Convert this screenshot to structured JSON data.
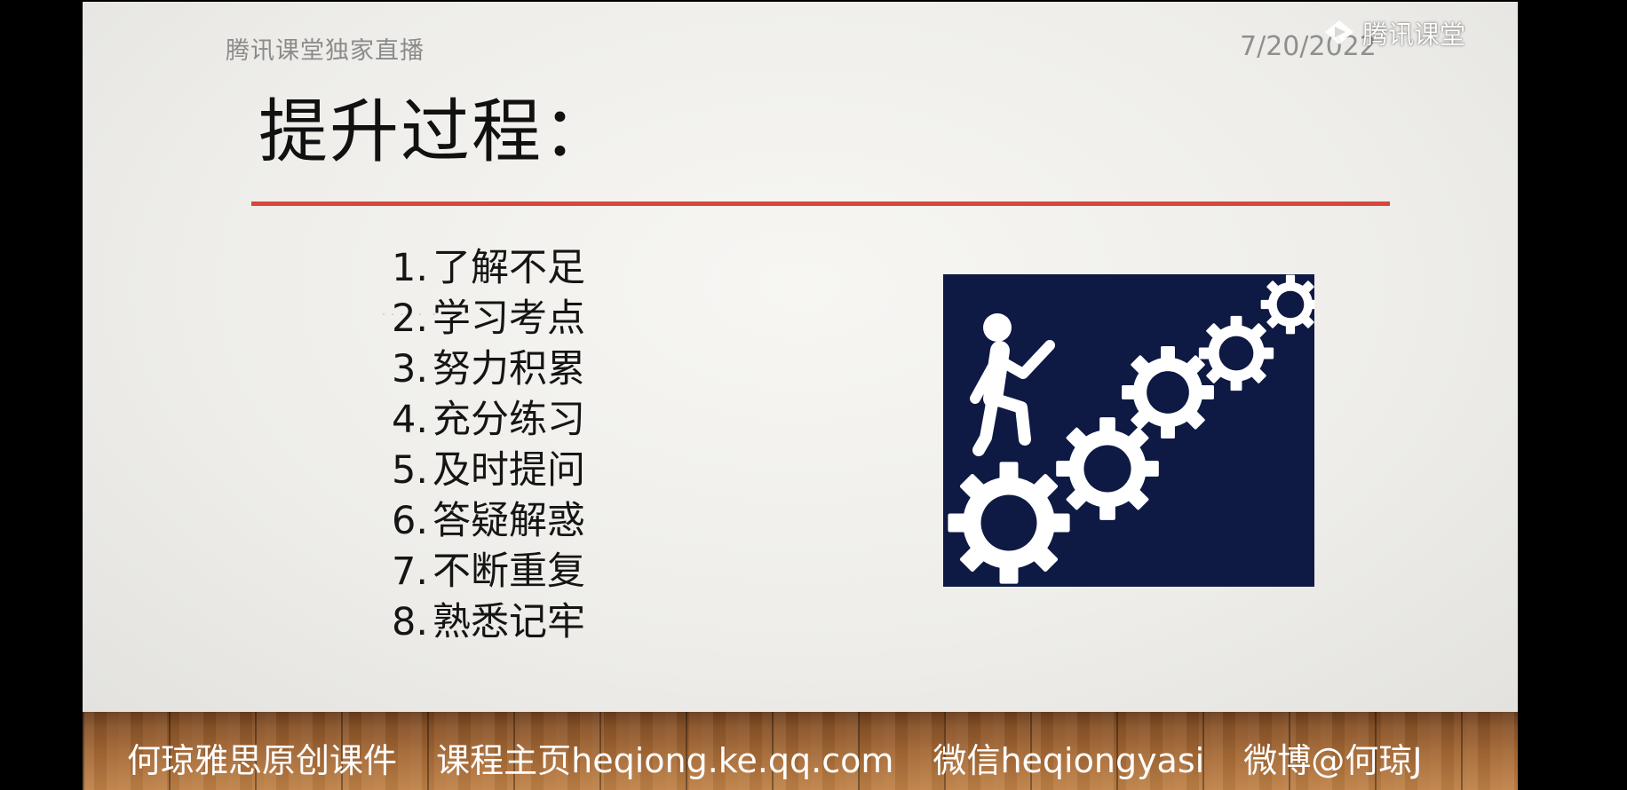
{
  "slide": {
    "header_left": "腾讯课堂独家直播",
    "date": "7/20/2022",
    "title": "提升过程：",
    "steps": [
      {
        "num": "1.",
        "text": "了解不足"
      },
      {
        "num": "2.",
        "text": "学习考点"
      },
      {
        "num": "3.",
        "text": "努力积累"
      },
      {
        "num": "4.",
        "text": "充分练习"
      },
      {
        "num": "5.",
        "text": "及时提问"
      },
      {
        "num": "6.",
        "text": "答疑解惑"
      },
      {
        "num": "7.",
        "text": "不断重复"
      },
      {
        "num": "8.",
        "text": "熟悉记牢"
      }
    ],
    "illustration_icon": "person-climbing-gears-icon",
    "colors": {
      "title_rule": "#d9473a",
      "illustration_bg": "#0e1a44"
    }
  },
  "footer": {
    "items": [
      "何琼雅思原创课件",
      "课程主页heqiong.ke.qq.com",
      "微信heqiongyasi",
      "微博@何琼J"
    ]
  },
  "watermark": {
    "logo_icon": "tencent-classroom-logo-icon",
    "label": "腾讯课堂"
  }
}
